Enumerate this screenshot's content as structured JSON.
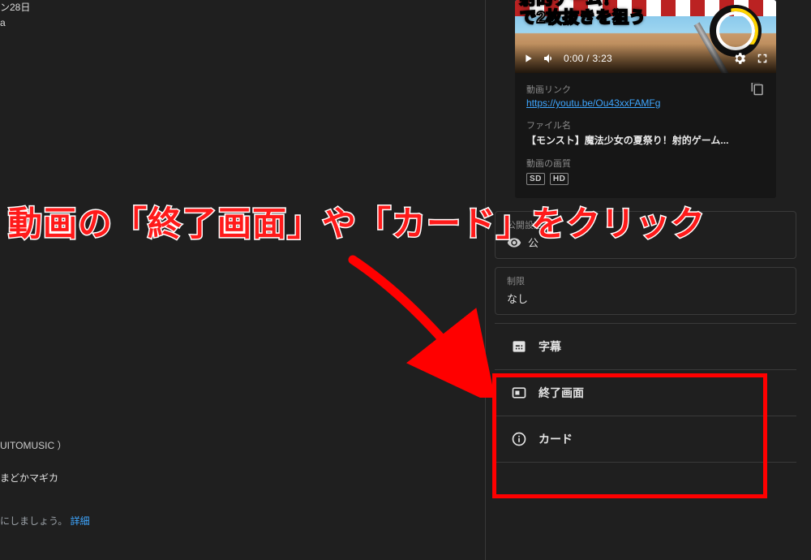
{
  "left": {
    "top_line1": "ン28日",
    "top_line2": "a",
    "artist_line": "UITOMUSIC ）",
    "anime_line": "まどかマギカ",
    "footer_text": "にしましょう。",
    "detail_link": "詳細"
  },
  "preview": {
    "thumb_text_line1": "射的ゲーム！",
    "thumb_text_line2": "で2枚抜きを狙う",
    "time": "0:00 / 3:23",
    "link_label": "動画リンク",
    "link_url": "https://youtu.be/Ou43xxFAMFg",
    "filename_label": "ファイル名",
    "filename_value": "【モンスト】魔法少女の夏祭り！射的ゲーム...",
    "quality_label": "動画の画質",
    "badge_sd": "SD",
    "badge_hd": "HD"
  },
  "settings": {
    "visibility_label": "公開設定",
    "visibility_value": "公",
    "restriction_label": "制限",
    "restriction_value": "なし",
    "subtitle_label": "字幕",
    "endscreen_label": "終了画面",
    "card_label": "カード"
  },
  "annotation": {
    "text": "動画の「終了画面」や「カード」をクリック"
  }
}
